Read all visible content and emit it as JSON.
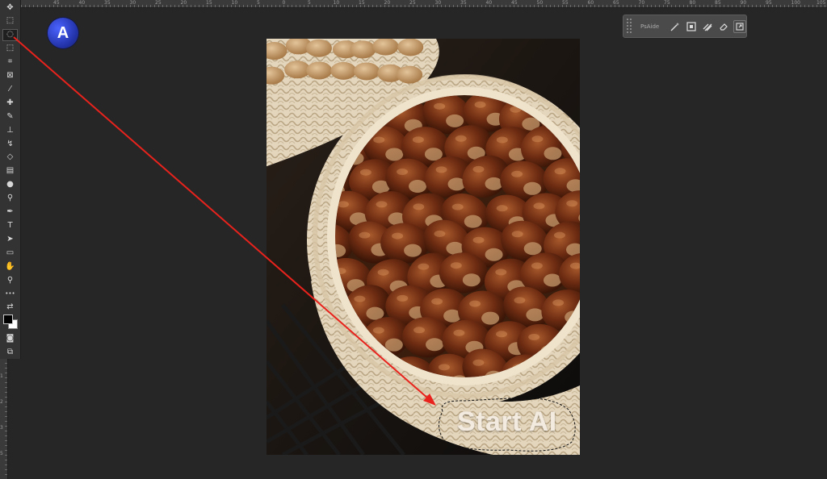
{
  "ruler": {
    "top_numbers": [
      "45",
      "40",
      "35",
      "30",
      "25",
      "20",
      "15",
      "10",
      "5",
      "0",
      "5",
      "10",
      "15",
      "20",
      "25",
      "30",
      "35",
      "40",
      "45",
      "50",
      "55",
      "60",
      "65",
      "70",
      "75",
      "80",
      "85",
      "90",
      "95",
      "100",
      "105"
    ],
    "left_numbers": [
      "1",
      "2",
      "3",
      "5"
    ]
  },
  "toolbar": {
    "tools": [
      {
        "name": "move-tool",
        "icon": "move-icon",
        "glyph": "✥"
      },
      {
        "name": "marquee-tool",
        "icon": "marquee-icon",
        "glyph": "⬚"
      },
      {
        "name": "lasso-tool",
        "icon": "lasso-icon",
        "glyph": "◌",
        "active": true
      },
      {
        "name": "object-select-tool",
        "icon": "object-select-icon",
        "glyph": "⬚"
      },
      {
        "name": "crop-tool",
        "icon": "crop-icon",
        "glyph": "⌗"
      },
      {
        "name": "frame-tool",
        "icon": "frame-icon",
        "glyph": "⊠"
      },
      {
        "name": "eyedropper-tool",
        "icon": "eyedropper-icon",
        "glyph": "⁄"
      },
      {
        "name": "healing-brush-tool",
        "icon": "healing-icon",
        "glyph": "✚"
      },
      {
        "name": "brush-tool",
        "icon": "brush-icon",
        "glyph": "✎"
      },
      {
        "name": "clone-stamp-tool",
        "icon": "stamp-icon",
        "glyph": "⊥"
      },
      {
        "name": "history-brush-tool",
        "icon": "history-brush-icon",
        "glyph": "↯"
      },
      {
        "name": "eraser-tool",
        "icon": "eraser-icon",
        "glyph": "◇"
      },
      {
        "name": "gradient-tool",
        "icon": "gradient-icon",
        "glyph": "▤"
      },
      {
        "name": "blur-tool",
        "icon": "blur-icon",
        "glyph": "●"
      },
      {
        "name": "dodge-tool",
        "icon": "dodge-icon",
        "glyph": "⚲"
      },
      {
        "name": "pen-tool",
        "icon": "pen-icon",
        "glyph": "✒"
      },
      {
        "name": "type-tool",
        "icon": "type-icon",
        "glyph": "T"
      },
      {
        "name": "path-selection-tool",
        "icon": "path-selection-icon",
        "glyph": "➤"
      },
      {
        "name": "rectangle-tool",
        "icon": "rectangle-icon",
        "glyph": "▭"
      },
      {
        "name": "hand-tool",
        "icon": "hand-icon",
        "glyph": "✋"
      },
      {
        "name": "zoom-tool",
        "icon": "zoom-icon",
        "glyph": "⚲"
      },
      {
        "name": "more-tools",
        "icon": "more-icon",
        "glyph": "•••"
      },
      {
        "name": "swap-colors",
        "icon": "swap-colors-icon",
        "glyph": "⇄"
      }
    ],
    "bottom_tools": [
      {
        "name": "quick-mask-tool",
        "icon": "quick-mask-icon",
        "glyph": "◙"
      },
      {
        "name": "screen-mode-tool",
        "icon": "screen-mode-icon",
        "glyph": "⧉"
      }
    ],
    "foreground_color": "#000000",
    "background_color": "#ffffff"
  },
  "logo": {
    "letter": "A",
    "icon": "app-logo-icon"
  },
  "plugin_panel": {
    "title": "PsAide",
    "buttons": [
      {
        "name": "magic-wand-button",
        "icon": "magic-wand-icon"
      },
      {
        "name": "select-subject-button",
        "icon": "select-subject-icon"
      },
      {
        "name": "stripes-button",
        "icon": "stripes-icon"
      },
      {
        "name": "eraser-button",
        "icon": "eraser-icon"
      },
      {
        "name": "expand-button",
        "icon": "expand-icon"
      }
    ]
  },
  "canvas": {
    "overlay_text": "Start AI"
  },
  "colors": {
    "annotation_arrow": "#e8221c",
    "workspace": "#262626"
  }
}
